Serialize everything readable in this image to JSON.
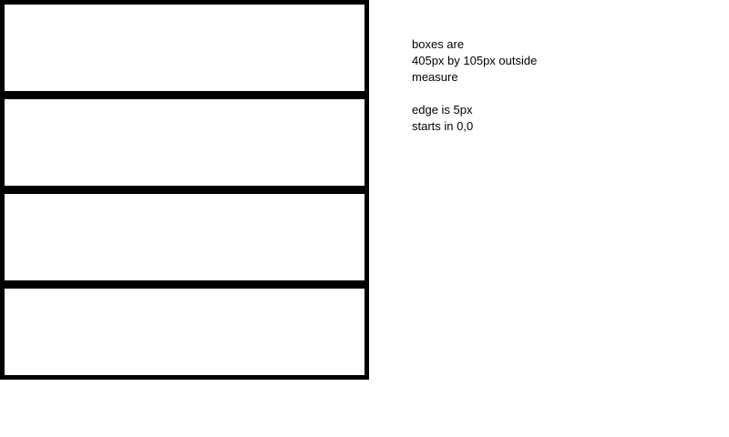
{
  "notes": {
    "line1": "boxes are",
    "line2": "405px by 105px outside",
    "line3": "measure",
    "line4": "edge is 5px",
    "line5": "starts in 0,0"
  }
}
